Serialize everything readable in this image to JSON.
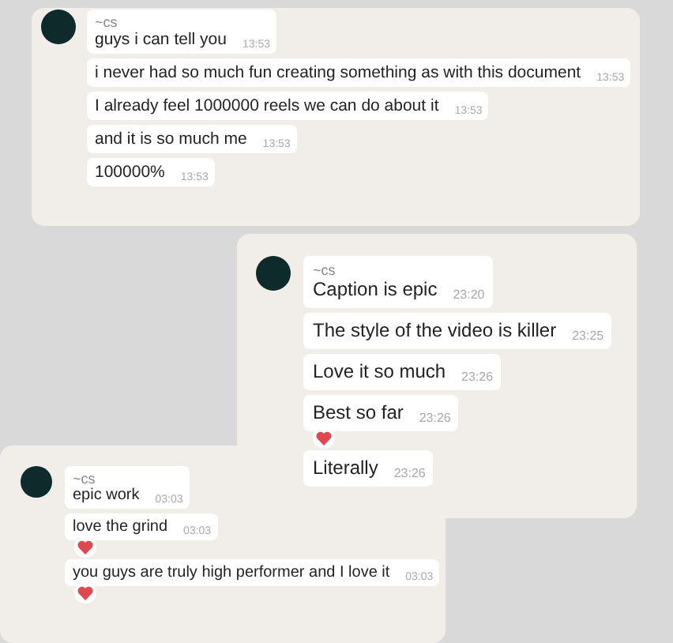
{
  "chats": [
    {
      "sender": "~cs",
      "messages": [
        {
          "text": "guys i can tell you",
          "time": "13:53",
          "reaction": false
        },
        {
          "text": "i never had so much fun creating something as with this document",
          "time": "13:53",
          "reaction": false
        },
        {
          "text": "I already feel 1000000 reels we can do about it",
          "time": "13:53",
          "reaction": false
        },
        {
          "text": "and it is so much me",
          "time": "13:53",
          "reaction": false
        },
        {
          "text": "100000%",
          "time": "13:53",
          "reaction": false
        }
      ]
    },
    {
      "sender": "~cs",
      "messages": [
        {
          "text": "Caption is epic",
          "time": "23:20",
          "reaction": false
        },
        {
          "text": "The style of the video is killer",
          "time": "23:25",
          "reaction": false
        },
        {
          "text": "Love it so much",
          "time": "23:26",
          "reaction": false
        },
        {
          "text": "Best so far",
          "time": "23:26",
          "reaction": true
        },
        {
          "text": "Literally",
          "time": "23:26",
          "reaction": false
        }
      ]
    },
    {
      "sender": "~cs",
      "messages": [
        {
          "text": "epic work",
          "time": "03:03",
          "reaction": false
        },
        {
          "text": "love the grind",
          "time": "03:03",
          "reaction": true
        },
        {
          "text": "you guys are truly high performer and I love it",
          "time": "03:03",
          "reaction": true
        }
      ]
    }
  ]
}
